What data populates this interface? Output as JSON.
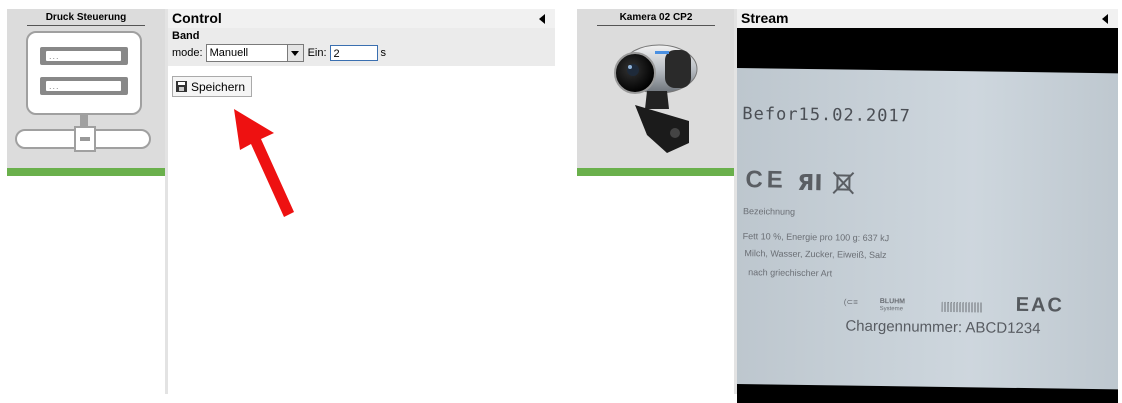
{
  "left_device": {
    "title": "Druck Steuerung",
    "icon": "server-icon",
    "status_color": "#6ab04c",
    "drive_text": "..."
  },
  "control_panel": {
    "title": "Control",
    "band": {
      "title": "Band",
      "mode_label": "mode:",
      "mode_value": "Manuell",
      "ein_label": "Ein:",
      "ein_value": "2",
      "unit": "s"
    },
    "save_label": "Speichern"
  },
  "camera_device": {
    "title": "Kamera 02 CP2",
    "icon": "webcam-icon",
    "status_color": "#6ab04c"
  },
  "stream_panel": {
    "title": "Stream",
    "frame": {
      "date": "Befor15.02.2017",
      "marks": "CE",
      "line1": "Bezeichnung",
      "line2": "Fett 10 %, Energie pro 100 g: 637 kJ",
      "line3": "Milch, Wasser, Zucker, Eiweiß, Salz",
      "line4": "nach griechischer Art",
      "logo_text": "BLUHM",
      "logo_sub": "Systeme",
      "eac": "EAC",
      "charge": "Chargennummer: ABCD1234"
    }
  },
  "annotation": {
    "arrow_color": "#ee1111"
  }
}
